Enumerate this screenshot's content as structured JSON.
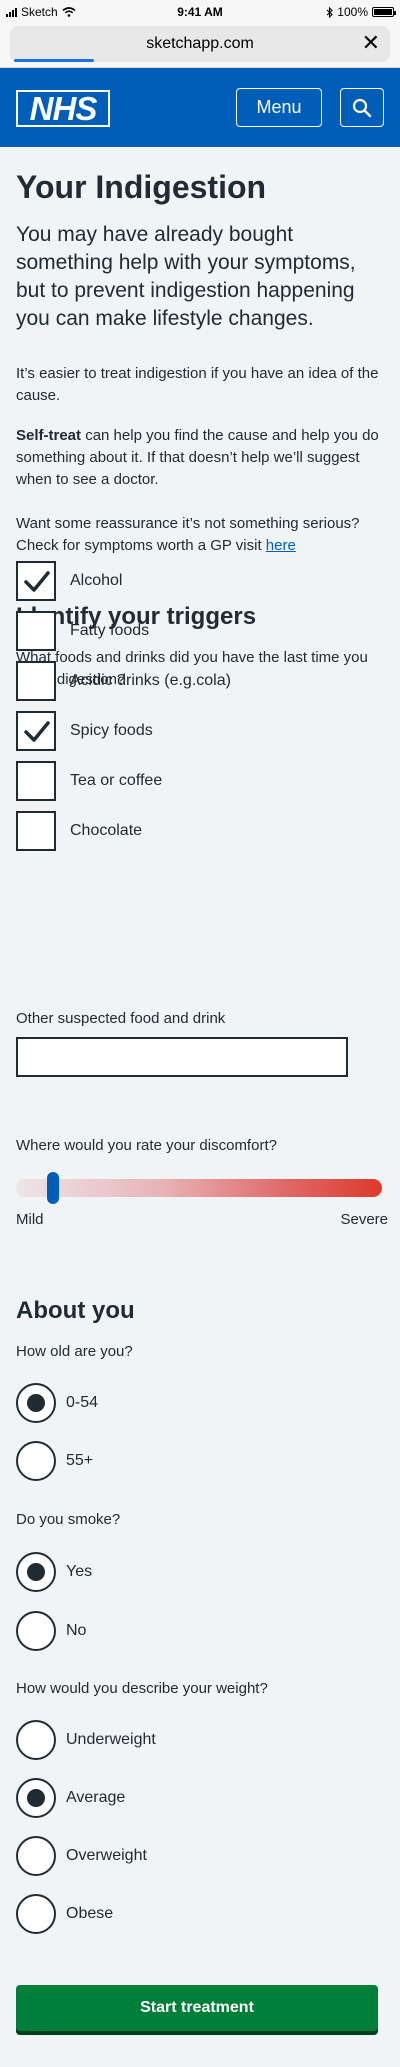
{
  "status_bar": {
    "carrier": "Sketch",
    "time": "9:41 AM",
    "battery": "100%"
  },
  "browser": {
    "url": "sketchapp.com",
    "close_glyph": "✕"
  },
  "header": {
    "logo_text": "NHS",
    "menu_label": "Menu",
    "search_icon": "search-icon"
  },
  "page": {
    "title": "Your Indigestion",
    "lead": "You may have already bought something help with your symptoms, but to prevent indigestion happening you can make lifestyle changes.",
    "para1": "It’s easier to treat indigestion if you have an idea of the cause.",
    "para2_bold": "Self-treat",
    "para2_rest": " can help you find the cause and help you do something about it.  If that doesn’t help we’ll suggest when to see a doctor.",
    "para3_text": "Want some reassurance it’s not something serious? Check for symptoms worth a GP visit ",
    "para3_link": "here"
  },
  "triggers": {
    "heading": "Identify your triggers",
    "question": "What foods and drinks did you have the last time you had indigestion?",
    "options": [
      {
        "label": "Alcohol",
        "checked": true
      },
      {
        "label": "Fatty foods",
        "checked": false
      },
      {
        "label": "Acidic drinks (e.g.cola)",
        "checked": false
      },
      {
        "label": "Spicy foods",
        "checked": true
      },
      {
        "label": "Tea or coffee",
        "checked": false
      },
      {
        "label": "Chocolate",
        "checked": false
      }
    ],
    "other_label": "Other suspected food and drink",
    "other_value": ""
  },
  "discomfort": {
    "question": "Where would you rate your discomfort?",
    "min_label": "Mild",
    "max_label": "Severe",
    "value_fraction": 0.1
  },
  "about": {
    "heading": "About you",
    "age": {
      "question": "How old are you?",
      "options": [
        "0-54",
        "55+"
      ],
      "selected": "0-54"
    },
    "smoke": {
      "question": "Do you smoke?",
      "options": [
        "Yes",
        "No"
      ],
      "selected": "Yes"
    },
    "weight": {
      "question": "How would you describe your weight?",
      "options": [
        "Underweight",
        "Average",
        "Overweight",
        "Obese"
      ],
      "selected": "Average"
    }
  },
  "cta": {
    "label": "Start treatment"
  },
  "colors": {
    "nhs_blue": "#005eb8",
    "button_green": "#007f3b",
    "text": "#212b32",
    "page_bg": "#f0f4f5"
  }
}
